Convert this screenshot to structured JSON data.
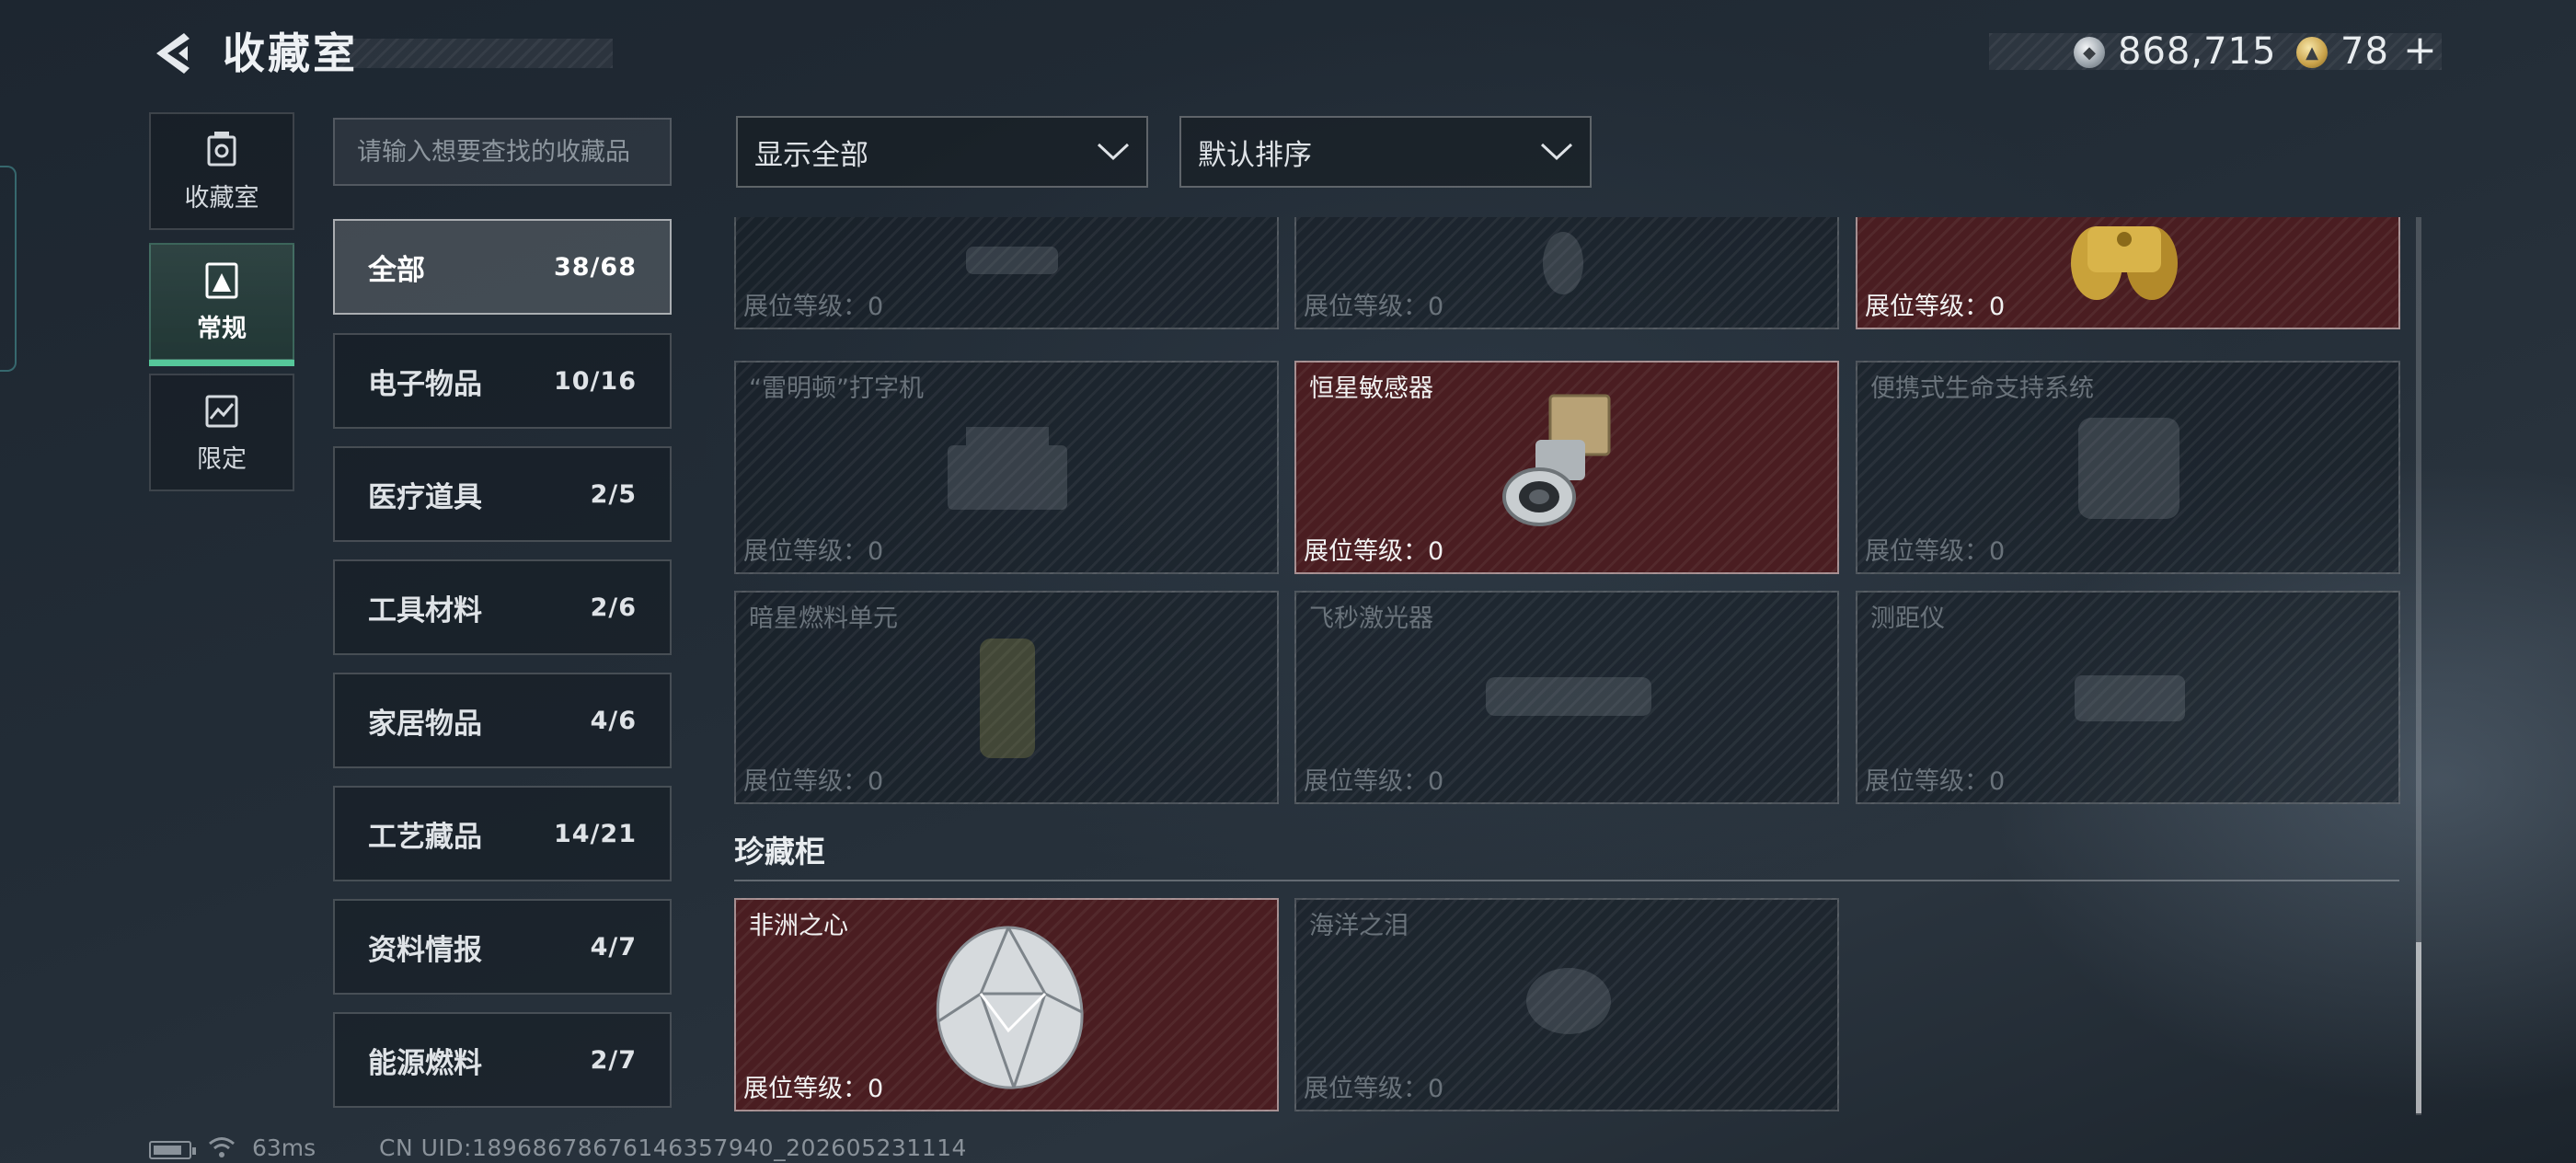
{
  "header": {
    "title": "收藏室",
    "silver_coin": "868,715",
    "gold_coin": "78",
    "plus": "+"
  },
  "nav": [
    {
      "label": "收藏室",
      "icon": "vault-icon"
    },
    {
      "label": "常规",
      "icon": "regular-icon"
    },
    {
      "label": "限定",
      "icon": "limited-icon"
    }
  ],
  "search": {
    "placeholder": "请输入想要查找的收藏品"
  },
  "categories": [
    {
      "label": "全部",
      "count": "38/68"
    },
    {
      "label": "电子物品",
      "count": "10/16"
    },
    {
      "label": "医疗道具",
      "count": "2/5"
    },
    {
      "label": "工具材料",
      "count": "2/6"
    },
    {
      "label": "家居物品",
      "count": "4/6"
    },
    {
      "label": "工艺藏品",
      "count": "14/21"
    },
    {
      "label": "资料情报",
      "count": "4/7"
    },
    {
      "label": "能源燃料",
      "count": "2/7"
    }
  ],
  "filters": {
    "filter": "显示全部",
    "sort": "默认排序"
  },
  "level_label": "展位等级：",
  "level_value": "0",
  "items": [
    {
      "name": "",
      "owned": false
    },
    {
      "name": "",
      "owned": false
    },
    {
      "name": "",
      "owned": true
    },
    {
      "name": "“雷明顿”打字机",
      "owned": false
    },
    {
      "name": "恒星敏感器",
      "owned": true
    },
    {
      "name": "便携式生命支持系统",
      "owned": false
    },
    {
      "name": "暗星燃料单元",
      "owned": false
    },
    {
      "name": "飞秒激光器",
      "owned": false
    },
    {
      "name": "测距仪",
      "owned": false
    }
  ],
  "cabinet": {
    "title": "珍藏柜",
    "items": [
      {
        "name": "非洲之心",
        "owned": true
      },
      {
        "name": "海洋之泪",
        "owned": false
      }
    ]
  },
  "status": {
    "ping": "63ms",
    "uid": "CN UID:18968678676146357940_202605231114"
  },
  "colors": {
    "owned_card": "#4a1d21",
    "active_nav_accent": "#56c79a",
    "background": "#232d37"
  }
}
